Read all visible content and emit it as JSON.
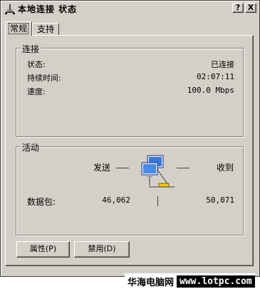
{
  "window": {
    "title": "本地连接 状态",
    "help_btn": "?",
    "close_btn": "X"
  },
  "tabs": [
    {
      "label": "常规"
    },
    {
      "label": "支持"
    }
  ],
  "connection": {
    "group_label": "连接",
    "status_label": "状态:",
    "status_value": "已连接",
    "duration_label": "持续时间:",
    "duration_value": "02:07:11",
    "speed_label": "速度:",
    "speed_value": "100.0 Mbps"
  },
  "activity": {
    "group_label": "活动",
    "sent_label": "发送",
    "received_label": "收到",
    "packets_label": "数据包:",
    "packets_sent": "46,062",
    "packets_received": "50,071"
  },
  "buttons": {
    "properties": "属性(P)",
    "disable": "禁用(D)"
  },
  "watermark": {
    "cn": "华海电脑网",
    "url": "www.lotpc.com"
  },
  "icons": {
    "title": "network-connection-icon",
    "activity": "network-computers-icon"
  }
}
